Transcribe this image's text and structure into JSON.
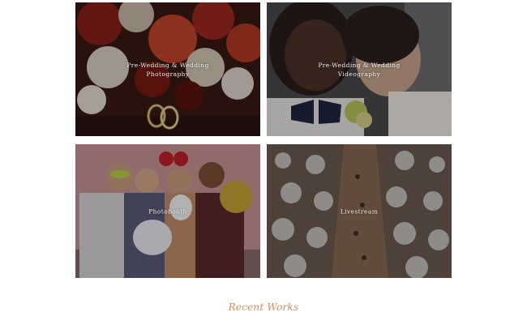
{
  "gallery": {
    "tiles": [
      {
        "label_line1": "Pre-Wedding & Wedding",
        "label_line2": "Photography",
        "image": "bouquet-and-rings-photo"
      },
      {
        "label_line1": "Pre-Wedding & Wedding",
        "label_line2": "Videography",
        "image": "couple-embrace-photo"
      },
      {
        "label_line1": "Photobooth",
        "label_line2": "",
        "image": "photobooth-group-photo"
      },
      {
        "label_line1": "Livestream",
        "label_line2": "",
        "image": "banquet-hall-aerial-photo"
      }
    ]
  },
  "section": {
    "recent_works_heading": "Recent Works"
  },
  "colors": {
    "heading_accent": "#c98d68",
    "overlay_text": "#f3f0ea"
  }
}
